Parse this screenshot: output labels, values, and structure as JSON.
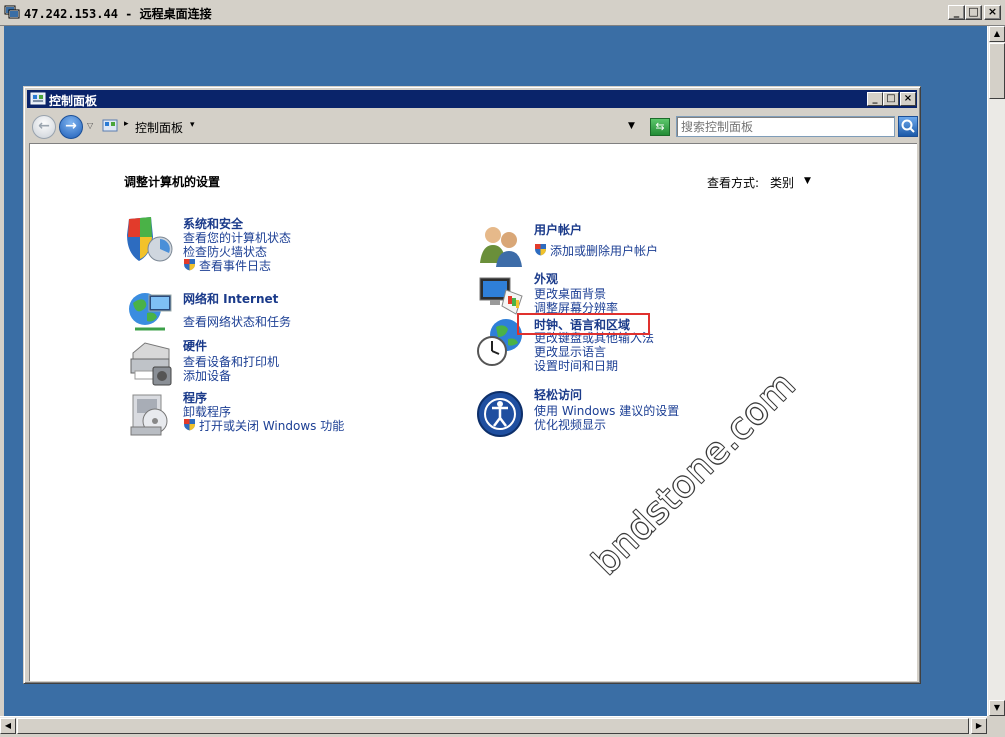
{
  "rdp": {
    "title": "47.242.153.44 - 远程桌面连接",
    "minimize": "_",
    "maximize": "□",
    "close": "×"
  },
  "window": {
    "title": "控制面板",
    "minimize": "_",
    "maximize": "□",
    "close": "×"
  },
  "toolbar": {
    "address": "控制面板",
    "search_placeholder": "搜索控制面板"
  },
  "page": {
    "heading": "调整计算机的设置",
    "view_by_label": "查看方式:",
    "view_by_value": "类别"
  },
  "categories_left": [
    {
      "title": "系统和安全",
      "icon": "system-security-icon",
      "links": [
        {
          "label": "查看您的计算机状态",
          "shield": false
        },
        {
          "label": "检查防火墙状态",
          "shield": false
        },
        {
          "label": "查看事件日志",
          "shield": true
        }
      ]
    },
    {
      "title": "网络和 Internet",
      "icon": "network-icon",
      "links": [
        {
          "label": "查看网络状态和任务",
          "shield": false
        }
      ]
    },
    {
      "title": "硬件",
      "icon": "printer-icon",
      "links": [
        {
          "label": "查看设备和打印机",
          "shield": false
        },
        {
          "label": "添加设备",
          "shield": false
        }
      ]
    },
    {
      "title": "程序",
      "icon": "programs-icon",
      "links": [
        {
          "label": "卸载程序",
          "shield": false
        },
        {
          "label": "打开或关闭 Windows 功能",
          "shield": true
        }
      ]
    }
  ],
  "categories_right": [
    {
      "title": "用户帐户",
      "icon": "users-icon",
      "links": [
        {
          "label": "添加或删除用户帐户",
          "shield": true
        }
      ]
    },
    {
      "title": "外观",
      "icon": "appearance-icon",
      "links": [
        {
          "label": "更改桌面背景",
          "shield": false
        },
        {
          "label": "调整屏幕分辨率",
          "shield": false
        }
      ]
    },
    {
      "title": "时钟、语言和区域",
      "icon": "clock-globe-icon",
      "links": [
        {
          "label": "更改键盘或其他输入法",
          "shield": false
        },
        {
          "label": "更改显示语言",
          "shield": false
        },
        {
          "label": "设置时间和日期",
          "shield": false
        }
      ]
    },
    {
      "title": "轻松访问",
      "icon": "ease-of-access-icon",
      "links": [
        {
          "label": "使用 Windows 建议的设置",
          "shield": false
        },
        {
          "label": "优化视频显示",
          "shield": false
        }
      ]
    }
  ],
  "watermark": "bndstone.com",
  "colors": {
    "desktop": "#3a6ea5",
    "titlebar": "#0a246a",
    "link": "#1c3f94",
    "highlight": "#e0312e"
  }
}
